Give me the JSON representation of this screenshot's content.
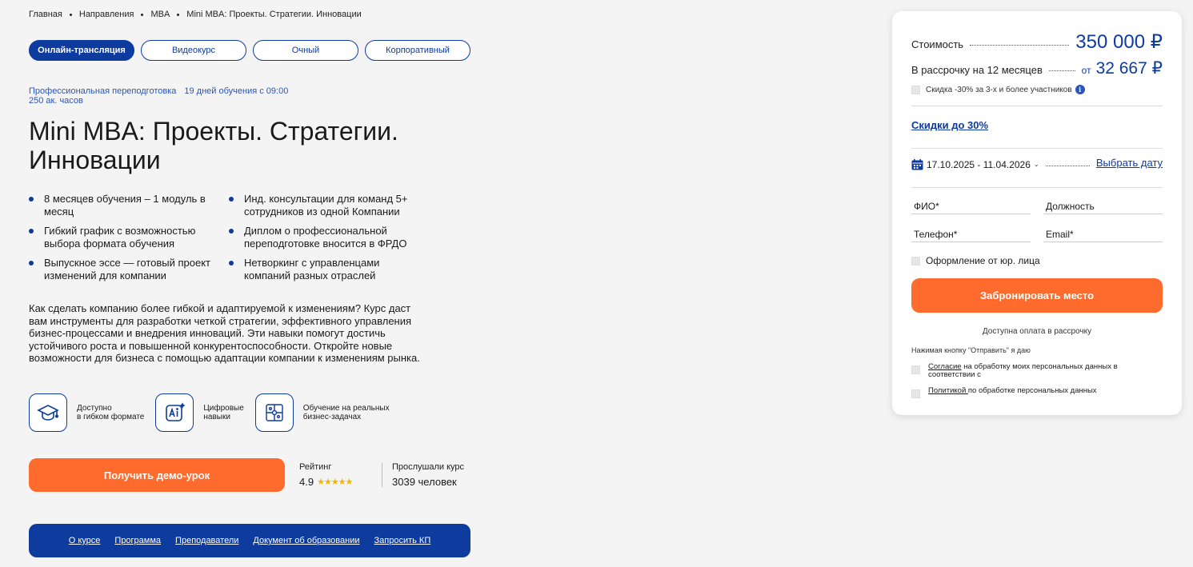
{
  "breadcrumb": [
    "Главная",
    "Направления",
    "MBA",
    "Mini MBA: Проекты. Стратегии. Инновации"
  ],
  "formats": [
    {
      "label": "Онлайн-трансляция",
      "active": true
    },
    {
      "label": "Видеокурс",
      "active": false
    },
    {
      "label": "Очный",
      "active": false
    },
    {
      "label": "Корпоративный",
      "active": false
    }
  ],
  "meta": {
    "type": "Профессиональная переподготовка",
    "schedule": "19 дней обучения с 09:00",
    "hours": "250 ак. часов"
  },
  "title": "Mini MBA: Проекты. Стратегии. Инновации",
  "features": [
    "8 месяцев обучения – 1 модуль в месяц",
    "Инд. консультации для команд 5+ сотрудников из одной Компании",
    "Гибкий график с возможностью выбора формата обучения",
    "Диплом о профессиональной переподготовке вносится в ФРДО",
    "Выпускное эссе — готовый проект изменений для компании",
    "Нетворкинг с управленцами компаний разных отраслей"
  ],
  "description": "Как сделать компанию более гибкой и адаптируемой к изменениям? Курс даст вам инструменты для разработки четкой стратегии, эффективного управления бизнес-процессами и внедрения инноваций. Эти навыки помогут достичь устойчивого роста и повышенной конкурентоспособности. Откройте новые возможности для бизнеса с помощью адаптации компании к изменениям рынка.",
  "benefits": [
    {
      "icon": "graduation-cap-icon",
      "line1": "Доступно",
      "line2": "в гибком формате"
    },
    {
      "icon": "ai-icon",
      "line1": "Цифровые",
      "line2": "навыки"
    },
    {
      "icon": "puzzle-icon",
      "line1": "Обучение на реальных",
      "line2": "бизнес-задачах"
    }
  ],
  "demo_button": "Получить демо-урок",
  "rating": {
    "label": "Рейтинг",
    "value": "4.9",
    "stars": 5
  },
  "listened": {
    "label": "Прослушали курс",
    "value": "3039 человек"
  },
  "nav": [
    "О курсе",
    "Программа",
    "Преподаватели",
    "Документ об образовании",
    "Запросить КП"
  ],
  "card": {
    "price_label": "Стоимость",
    "price": "350 000 ₽",
    "installment_label": "В рассрочку на 12 месяцев",
    "installment_from": "от",
    "installment_price": "32 667 ₽",
    "group_discount": "Скидка -30% за 3-х и более участников",
    "discounts_link": "Скидки до 30%",
    "dates": "17.10.2025 - 11.04.2026",
    "pick_date": "Выбрать дату",
    "fields": {
      "name": "ФИО*",
      "position": "Должность",
      "phone": "Телефон*",
      "email": "Email*"
    },
    "legal_entity": "Оформление от юр. лица",
    "book_button": "Забронировать место",
    "payment_note": "Доступна оплата в рассрочку",
    "press_note": "Нажимая кнопку \"Отправить\" я даю",
    "consent1_link": "Согласие",
    "consent1_text": " на обработку моих персональных данных в соответствии с",
    "consent2_link": "Политикой ",
    "consent2_text": "по обработке персональных данных"
  },
  "colors": {
    "accent": "#0d3b9e",
    "cta": "#ff6b2c",
    "star": "#f5b400"
  }
}
